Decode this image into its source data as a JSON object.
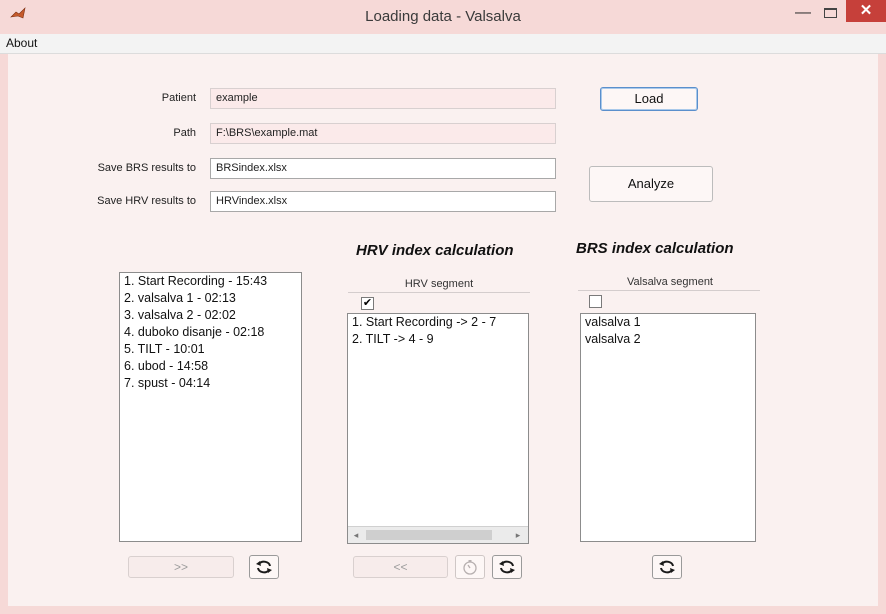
{
  "window": {
    "title": "Loading data - Valsalva",
    "minimize": "—",
    "close": "✕"
  },
  "menu": {
    "about": "About"
  },
  "form": {
    "patient_label": "Patient",
    "patient_value": "example",
    "path_label": "Path",
    "path_value": "F:\\BRS\\example.mat",
    "brs_label": "Save BRS results to",
    "brs_value": "BRSindex.xlsx",
    "hrv_label": "Save HRV results to",
    "hrv_value": "HRVindex.xlsx"
  },
  "buttons": {
    "load": "Load",
    "analyze": "Analyze",
    "forward": ">>",
    "back": "<<"
  },
  "left_list": {
    "items": [
      "1. Start Recording - 15:43",
      "2. valsalva 1 - 02:13",
      "3. valsalva 2 - 02:02",
      "4. duboko disanje - 02:18",
      "5. TILT - 10:01",
      "6. ubod - 14:58",
      "7. spust - 04:14"
    ]
  },
  "hrv": {
    "heading": "HRV index calculation",
    "segment_label": "HRV segment",
    "checked": true,
    "check_mark": "✔",
    "items": [
      "1. Start Recording -> 2 - 7",
      "2. TILT -> 4 - 9"
    ]
  },
  "brs": {
    "heading": "BRS index calculation",
    "segment_label": "Valsalva segment",
    "checked": false,
    "items": [
      "valsalva 1",
      "valsalva 2"
    ]
  },
  "icons": {
    "refresh": "refresh-icon",
    "timer": "stopwatch-icon",
    "app": "matlab-icon",
    "scroll_left": "◂",
    "scroll_right": "▸"
  }
}
